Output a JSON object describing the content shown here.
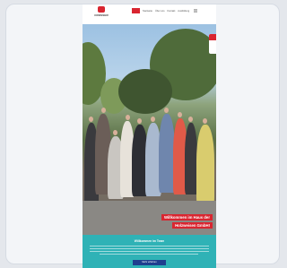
{
  "site": {
    "logo_text": "CROSSER",
    "nav": [
      "Startseite",
      "Über uns",
      "Kontakt",
      "Ausbildung",
      "Service"
    ],
    "headline": {
      "line1": "Willkommen im Haus der",
      "line2": "Holzweisen GmbH!"
    },
    "section": {
      "title": "Willkommen im Team",
      "button": "Mehr erfahren"
    }
  },
  "colors": {
    "brand_red": "#d92530",
    "teal": "#2fb2b6",
    "button_blue": "#1f3f8f"
  }
}
